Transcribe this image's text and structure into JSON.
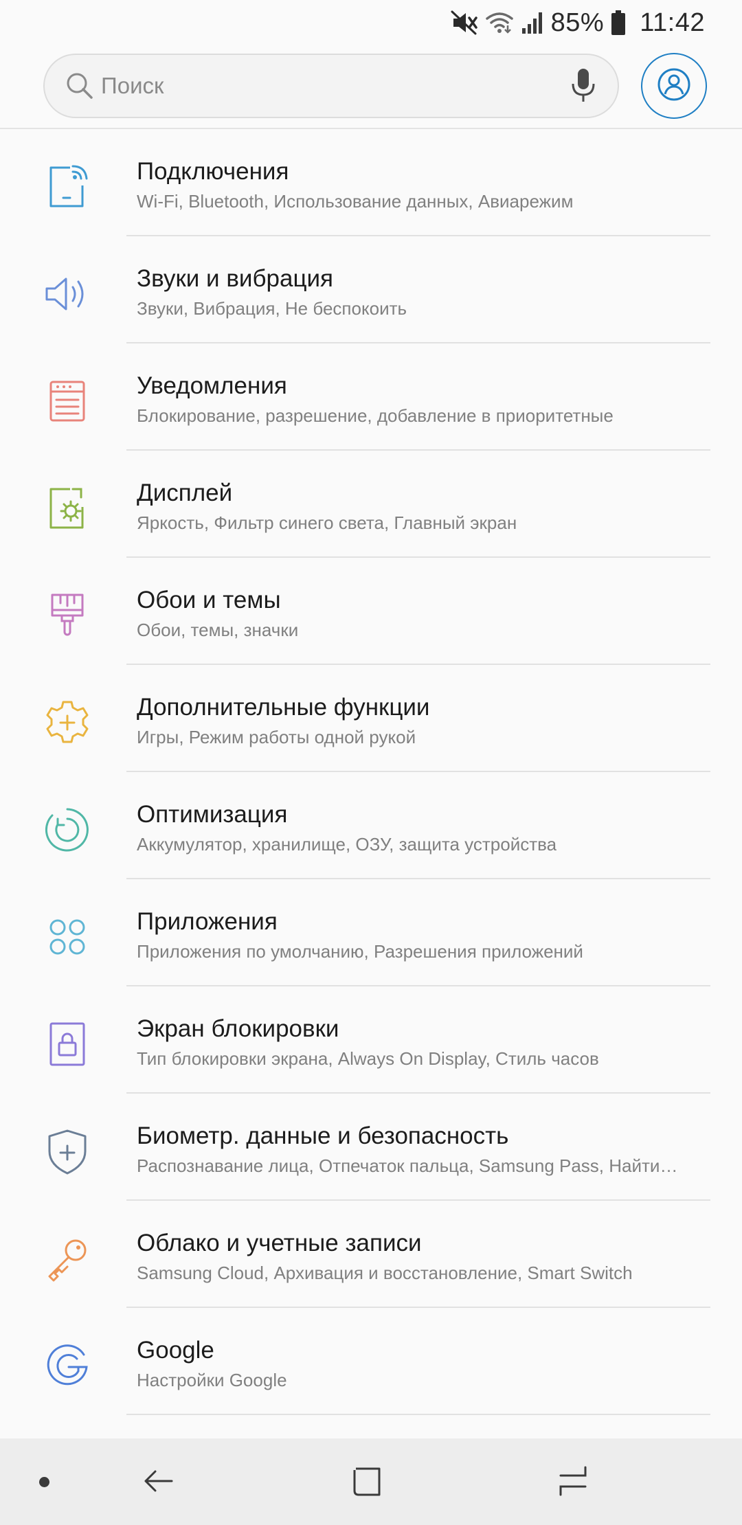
{
  "status_bar": {
    "battery": "85%",
    "time": "11:42"
  },
  "search": {
    "placeholder": "Поиск"
  },
  "colors": {
    "accent": "#1f7fc4",
    "connections": "#3f9bd2",
    "sounds": "#6a8fd8",
    "notifications": "#e8837a",
    "display": "#8cb347",
    "wallpapers": "#c47ac0",
    "advanced": "#e9b43f",
    "optimization": "#50b7a6",
    "apps": "#5fb5d4",
    "lockscreen": "#8b7ad8",
    "biometrics": "#6b7e96",
    "cloud": "#ec9556",
    "google": "#4f7fd8"
  },
  "settings": [
    {
      "icon": "connections-icon",
      "title": "Подключения",
      "subtitle": "Wi-Fi, Bluetooth, Использование данных, Авиарежим"
    },
    {
      "icon": "speaker-icon",
      "title": "Звуки и вибрация",
      "subtitle": "Звуки, Вибрация, Не беспокоить"
    },
    {
      "icon": "notifications-icon",
      "title": "Уведомления",
      "subtitle": "Блокирование, разрешение, добавление в приоритетные"
    },
    {
      "icon": "display-icon",
      "title": "Дисплей",
      "subtitle": "Яркость, Фильтр синего света, Главный экран"
    },
    {
      "icon": "paintbrush-icon",
      "title": "Обои и темы",
      "subtitle": "Обои, темы, значки"
    },
    {
      "icon": "gear-plus-icon",
      "title": "Дополнительные функции",
      "subtitle": "Игры, Режим работы одной рукой"
    },
    {
      "icon": "optimization-icon",
      "title": "Оптимизация",
      "subtitle": "Аккумулятор, хранилище, ОЗУ, защита устройства"
    },
    {
      "icon": "apps-icon",
      "title": "Приложения",
      "subtitle": "Приложения по умолчанию, Разрешения приложений"
    },
    {
      "icon": "lock-icon",
      "title": "Экран блокировки",
      "subtitle": "Тип блокировки экрана, Always On Display, Стиль часов"
    },
    {
      "icon": "shield-icon",
      "title": "Биометр. данные и безопасность",
      "subtitle": "Распознавание лица, Отпечаток пальца, Samsung Pass, Найти…"
    },
    {
      "icon": "key-icon",
      "title": "Облако и учетные записи",
      "subtitle": "Samsung Cloud, Архивация и восстановление, Smart Switch"
    },
    {
      "icon": "google-icon",
      "title": "Google",
      "subtitle": "Настройки Google"
    }
  ]
}
